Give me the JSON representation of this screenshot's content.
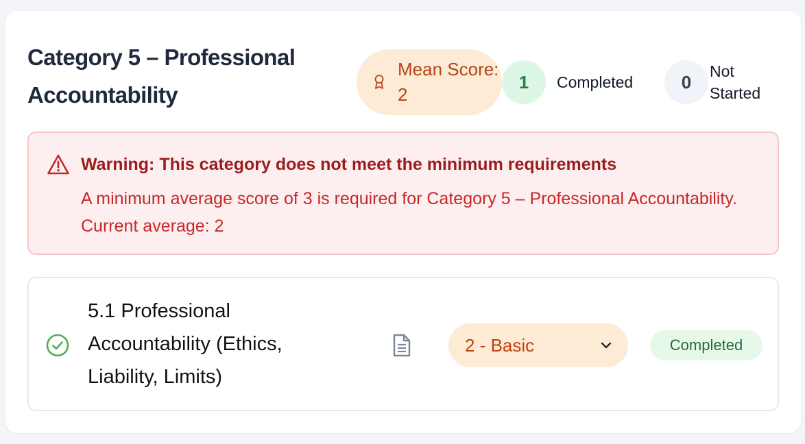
{
  "category": {
    "title": "Category 5 – Professional Accountability",
    "mean_score_label": "Mean Score: 2",
    "completed_count": "1",
    "completed_label": "Completed",
    "not_started_count": "0",
    "not_started_label": "Not Started"
  },
  "warning": {
    "title": "Warning: This category does not meet the minimum requirements",
    "message": "A minimum average score of 3 is required for Category 5 – Professional Accountability. Current average: 2"
  },
  "items": [
    {
      "title": "5.1 Professional Accountability (Ethics, Liability, Limits)",
      "score": "2 - Basic",
      "status": "Completed"
    }
  ],
  "icons": {
    "award": "award-icon",
    "warning": "warning-triangle-icon",
    "check": "check-circle-icon",
    "document": "document-icon",
    "chevron": "chevron-down-icon"
  },
  "colors": {
    "mean_pill_bg": "#fdebd6",
    "mean_pill_text": "#b5451b",
    "completed_bg": "#dcf7e5",
    "completed_text": "#2f7d3e",
    "warning_bg": "#fdeff0",
    "warning_border": "#f5c6c8",
    "warning_title": "#9b1c1c",
    "warning_text": "#c62828",
    "check_green": "#4caf50"
  }
}
